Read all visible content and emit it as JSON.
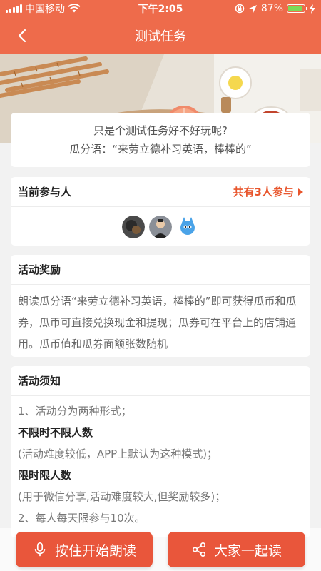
{
  "status": {
    "carrier": "中国移动",
    "time": "下午2:05",
    "battery": "87%",
    "battery_level": 0.87
  },
  "nav": {
    "title": "测试任务"
  },
  "intro": {
    "line1": "只是个测试任务好不好玩呢?",
    "line2": "瓜分语：“来劳立德补习英语，棒棒的”"
  },
  "participants": {
    "title": "当前参与人",
    "count_text": "共有3人参与"
  },
  "reward": {
    "title": "活动奖励",
    "text": "朗读瓜分语“来劳立德补习英语，棒棒的”即可获得瓜币和瓜券，瓜币可直接兑换现金和提现；瓜券可在平台上的店铺通用。瓜币值和瓜券面额张数随机"
  },
  "notice": {
    "title": "活动须知",
    "lines": [
      "1、活动分为两种形式；",
      "不限时不限人数",
      "(活动难度较低，APP上默认为这种模式)；",
      "限时限人数",
      "(用于微信分享,活动难度较大,但奖励较多)；",
      "2、每人每天限参与10次。"
    ]
  },
  "buttons": {
    "read": "按住开始朗读",
    "share": "大家一起读"
  },
  "colors": {
    "primary": "#ee6b4b",
    "accent": "#e8552c",
    "button": "#e9563b"
  }
}
